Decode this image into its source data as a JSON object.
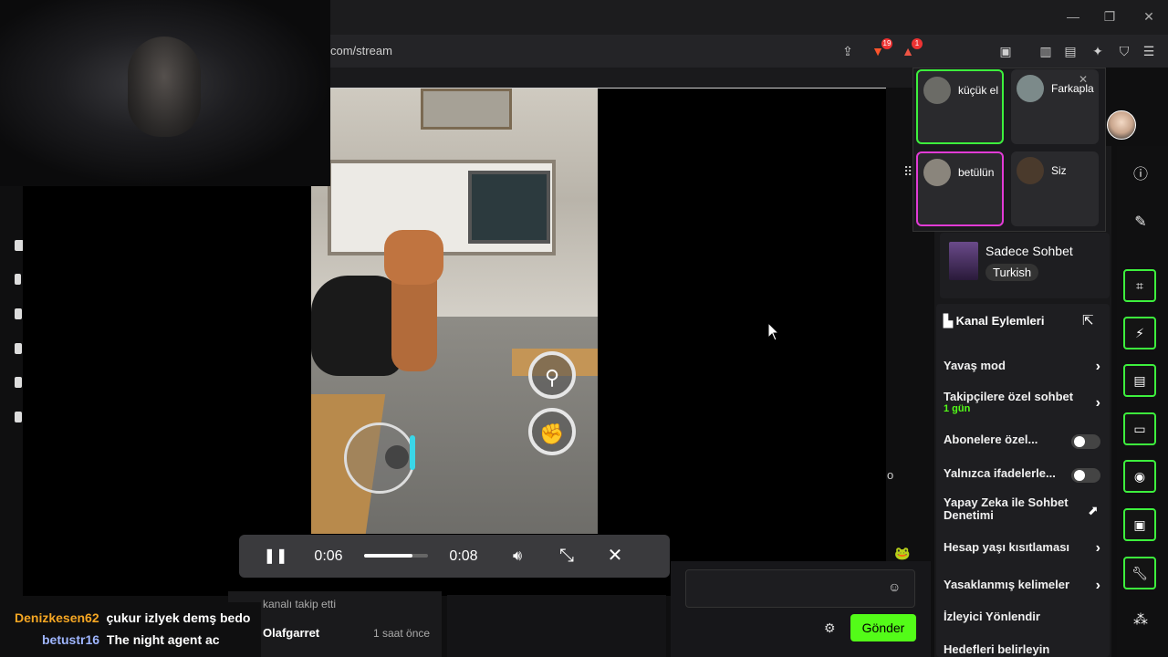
{
  "browser": {
    "url": "com/stream",
    "window_controls": {
      "minimize": "—",
      "maximize": "❐",
      "close": "✕"
    },
    "brave_badge": "19",
    "alert_badge": "1"
  },
  "video": {
    "current_time": "0:06",
    "duration": "0:08",
    "progress_fraction": 0.75
  },
  "call": {
    "participants": [
      {
        "name": "küçük el"
      },
      {
        "name": "Farkapla"
      },
      {
        "name": "betülün"
      },
      {
        "name": "Siz"
      }
    ],
    "close": "✕"
  },
  "stream_info": {
    "category": "Sadece Sohbet",
    "language_tag": "Turkish"
  },
  "channel_actions": {
    "title": "Kanal Eylemleri",
    "rows": [
      {
        "label": "Yavaş mod"
      },
      {
        "label": "Takipçilere özel sohbet",
        "sub": "1 gün"
      },
      {
        "label": "Abonelere özel..."
      },
      {
        "label": "Yalnızca ifadelerle..."
      },
      {
        "label": "Yapay Zeka ile Sohbet Denetimi"
      },
      {
        "label": "Hesap yaşı kısıtlaması"
      },
      {
        "label": "Yasaklanmış kelimeler"
      },
      {
        "label": "İzleyici Yönlendir"
      },
      {
        "label": "Hedefleri belirleyin"
      }
    ]
  },
  "chat": {
    "messages": [
      {
        "user": "Denizkesen62",
        "text": "çukur izlyek demş bedo",
        "color": "#f5a623"
      },
      {
        "user": "betustr16",
        "text": "The night agent ac",
        "color": "#9fb6ff"
      }
    ]
  },
  "activity": {
    "follow_text": "kanalı takip etti",
    "user": "Olafgarret",
    "time": "1 saat önce"
  },
  "composer": {
    "send_label": "Gönder"
  },
  "partial_text": {
    "o": "o"
  },
  "colors": {
    "accent_green": "#53fc18",
    "tile_active_green": "#3df03d",
    "tile_active_pink": "#e23bd6"
  }
}
